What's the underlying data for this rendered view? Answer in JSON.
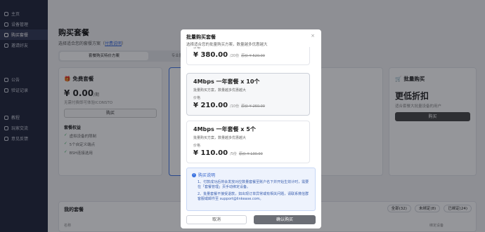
{
  "sidebar": {
    "items": [
      {
        "label": "主页",
        "icon": "home-icon"
      },
      {
        "label": "设备管理",
        "icon": "device-icon"
      },
      {
        "label": "购买套餐",
        "icon": "cart-icon",
        "active": true
      },
      {
        "label": "邀请好友",
        "icon": "invite-icon"
      }
    ],
    "items2": [
      {
        "label": "公告",
        "icon": "announcement-icon"
      },
      {
        "label": "验证记录",
        "icon": "record-icon"
      }
    ],
    "items3": [
      {
        "label": "教程",
        "icon": "tutorial-icon"
      },
      {
        "label": "玩家交流",
        "icon": "chat-icon"
      },
      {
        "label": "意见反馈",
        "icon": "feedback-icon"
      }
    ]
  },
  "page": {
    "title": "购买套餐",
    "subtitle_prefix": "选择适合您的套餐方案（",
    "subtitle_link": "付费说明",
    "subtitle_suffix": "）",
    "tabs": [
      "套餐购买特价方案",
      "专业服务器网络特价方案"
    ]
  },
  "free_plan": {
    "title": "免费套餐",
    "price": "¥ 0.00",
    "unit": "/期",
    "desc": "无需付费即可体验ICONSTO",
    "button": "购买",
    "perk_head": "套餐权益",
    "perks": [
      "虚拟设备的限制",
      "5个自定义端点",
      "BSH连接选用"
    ]
  },
  "bulk_plan": {
    "title": "批量购买",
    "big": "更低折扣",
    "desc": "适合套餐大批量设备的用户",
    "button": "购买"
  },
  "my_plans": {
    "title": "我的套餐",
    "filters": [
      "全部(32)",
      "未绑定(8)",
      "已绑定(24)"
    ],
    "columns": [
      "名称",
      "绑定设备"
    ]
  },
  "modal": {
    "title": "批量购买套餐",
    "subtitle": "选择适合您的批量购买方案，数量越多优惠越大",
    "close": "×",
    "packages": [
      {
        "name": "",
        "desc": "",
        "price_label": "价格",
        "price": "¥ 380.00",
        "unit": "/20份",
        "orig": "原价 ¥ 520.00"
      },
      {
        "name": "4Mbps 一年套餐 x 10个",
        "desc": "批量购买方案，数量越多优惠越大",
        "price_label": "价格",
        "price": "¥ 210.00",
        "unit": "/10份",
        "orig": "原价 ¥ 260.00"
      },
      {
        "name": "4Mbps 一年套餐 x 5个",
        "desc": "批量购买方案，数量越多优惠越大",
        "price_label": "价格",
        "price": "¥ 110.00",
        "unit": "/5份",
        "orig": "原价 ¥ 130.00"
      }
    ],
    "info": {
      "title": "购买说明",
      "lines": [
        "1、付款成功后将会发放对应数量套餐至账户名下并开始生效计时，需要在「套餐管理」页手动绑定设备。",
        "2、批量套餐不接受退款，如出现订单异常或有相关问题，请联系微信群客服或邮件至 support@linkease.com。"
      ]
    },
    "cancel": "取消",
    "confirm": "确认购买"
  }
}
